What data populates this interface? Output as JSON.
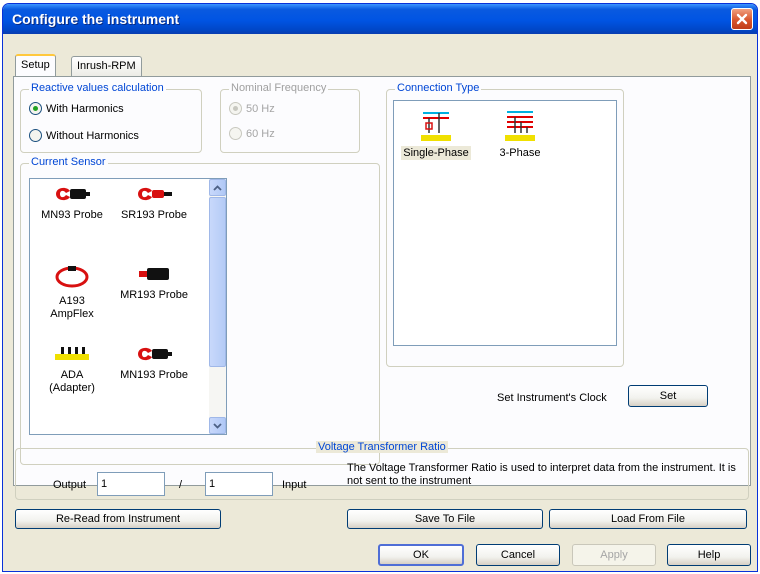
{
  "window": {
    "title": "Configure the instrument"
  },
  "tabs": [
    {
      "label": "Setup"
    },
    {
      "label": "Inrush-RPM"
    }
  ],
  "reactive": {
    "title": "Reactive values calculation",
    "options": [
      "With Harmonics",
      "Without Harmonics"
    ],
    "selected": "With Harmonics"
  },
  "frequency": {
    "title": "Nominal Frequency",
    "options": [
      "50 Hz",
      "60 Hz"
    ],
    "selected": "50 Hz"
  },
  "current_sensor": {
    "title": "Current Sensor",
    "items": [
      {
        "label": "MN93 Probe",
        "icon": "clamp-probe-icon"
      },
      {
        "label": "SR193 Probe",
        "icon": "clamp-probe-icon"
      },
      {
        "label_line1": "A193",
        "label_line2": "AmpFlex",
        "icon": "flex-loop-icon"
      },
      {
        "label": "MR193 Probe",
        "icon": "clamp-probe-icon"
      },
      {
        "label_line1": "ADA",
        "label_line2": "(Adapter)",
        "icon": "adapter-icon"
      },
      {
        "label": "MN193 Probe",
        "icon": "clamp-probe-icon"
      }
    ]
  },
  "connection": {
    "title": "Connection Type",
    "items": [
      "Single-Phase",
      "3-Phase"
    ],
    "selected": "Single-Phase"
  },
  "clock": {
    "label": "Set Instrument's Clock",
    "button": "Set"
  },
  "voltage": {
    "title": "Voltage Transformer Ratio",
    "output_label": "Output",
    "output_value": "1",
    "separator": "/",
    "input_value": "1",
    "input_label": "Input",
    "description": "The Voltage Transformer Ratio is used to interpret data from the instrument. It is not sent to the instrument"
  },
  "file_buttons": {
    "reread": "Re-Read from Instrument",
    "save": "Save To File",
    "load": "Load From File"
  },
  "dialog_buttons": {
    "ok": "OK",
    "cancel": "Cancel",
    "apply": "Apply",
    "help": "Help"
  },
  "colors": {
    "titlebar": "#0054e3",
    "group_label": "#0046d5",
    "probe_red": "#d81010",
    "adapter_yellow": "#f0e000"
  }
}
